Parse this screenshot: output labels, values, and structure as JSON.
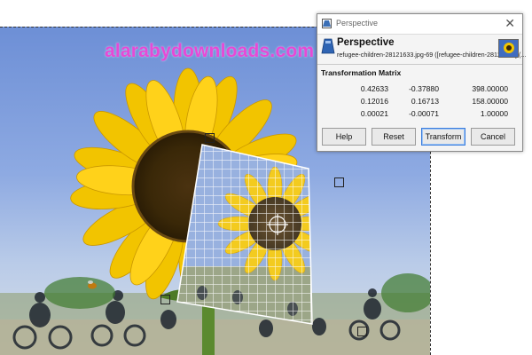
{
  "watermark": "alarabydownloads.com",
  "dialog": {
    "window_title": "Perspective",
    "heading": "Perspective",
    "subtitle": "refugee-children-28121633.jpg-69 ([refugee-children-28121633] (...",
    "matrix_label": "Transformation Matrix",
    "matrix": [
      [
        "0.42633",
        "-0.37880",
        "398.00000"
      ],
      [
        "0.12016",
        "0.16713",
        "158.00000"
      ],
      [
        "0.00021",
        "-0.00071",
        "1.00000"
      ]
    ],
    "buttons": {
      "help": "Help",
      "reset": "Reset",
      "transform": "Transform",
      "cancel": "Cancel"
    },
    "close_glyph": "✕"
  },
  "icons": {
    "window_icon": "perspective-tool-icon",
    "heading_icon": "perspective-tool-icon",
    "close": "close-icon"
  },
  "colors": {
    "watermark": "#e64ad6",
    "focus": "#3b7ddd"
  }
}
